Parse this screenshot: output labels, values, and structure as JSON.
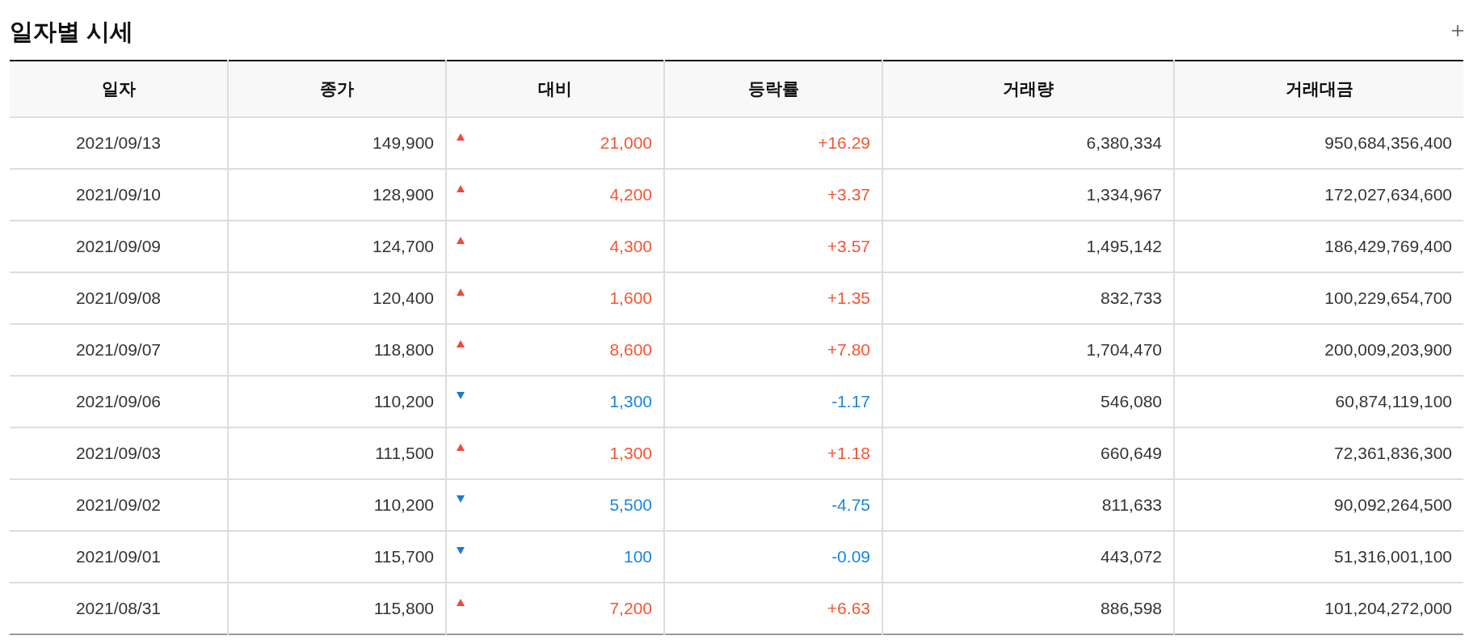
{
  "title": "일자별 시세",
  "columns": [
    "일자",
    "종가",
    "대비",
    "등락률",
    "거래량",
    "거래대금"
  ],
  "rows": [
    {
      "date": "2021/09/13",
      "close": "149,900",
      "rising": true,
      "change": "21,000",
      "rate": "+16.29",
      "volume": "6,380,334",
      "amount": "950,684,356,400"
    },
    {
      "date": "2021/09/10",
      "close": "128,900",
      "rising": true,
      "change": "4,200",
      "rate": "+3.37",
      "volume": "1,334,967",
      "amount": "172,027,634,600"
    },
    {
      "date": "2021/09/09",
      "close": "124,700",
      "rising": true,
      "change": "4,300",
      "rate": "+3.57",
      "volume": "1,495,142",
      "amount": "186,429,769,400"
    },
    {
      "date": "2021/09/08",
      "close": "120,400",
      "rising": true,
      "change": "1,600",
      "rate": "+1.35",
      "volume": "832,733",
      "amount": "100,229,654,700"
    },
    {
      "date": "2021/09/07",
      "close": "118,800",
      "rising": true,
      "change": "8,600",
      "rate": "+7.80",
      "volume": "1,704,470",
      "amount": "200,009,203,900"
    },
    {
      "date": "2021/09/06",
      "close": "110,200",
      "rising": false,
      "change": "1,300",
      "rate": "-1.17",
      "volume": "546,080",
      "amount": "60,874,119,100"
    },
    {
      "date": "2021/09/03",
      "close": "111,500",
      "rising": true,
      "change": "1,300",
      "rate": "+1.18",
      "volume": "660,649",
      "amount": "72,361,836,300"
    },
    {
      "date": "2021/09/02",
      "close": "110,200",
      "rising": false,
      "change": "5,500",
      "rate": "-4.75",
      "volume": "811,633",
      "amount": "90,092,264,500"
    },
    {
      "date": "2021/09/01",
      "close": "115,700",
      "rising": false,
      "change": "100",
      "rate": "-0.09",
      "volume": "443,072",
      "amount": "51,316,001,100"
    },
    {
      "date": "2021/08/31",
      "close": "115,800",
      "rising": true,
      "change": "7,200",
      "rate": "+6.63",
      "volume": "886,598",
      "amount": "101,204,272,000"
    }
  ]
}
